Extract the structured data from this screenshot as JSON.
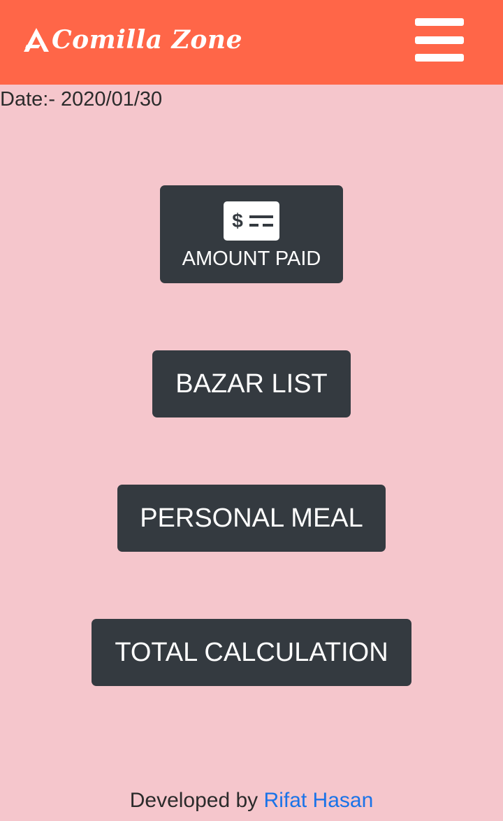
{
  "navbar": {
    "brand": "Comilla Zone",
    "menu_icon": "hamburger-menu-icon",
    "background_color": "#ff6648"
  },
  "date": {
    "text": "Date:- 2020/01/30"
  },
  "buttons": {
    "amount_paid": {
      "label": "AMOUNT PAID",
      "icon": "money-check-icon"
    },
    "bazar_list": {
      "label": "BAZAR LIST"
    },
    "personal_meal": {
      "label": "PERSONAL MEAL"
    },
    "total_calculation": {
      "label": "TOTAL CALCULATION"
    },
    "color": "#343a40"
  },
  "footer": {
    "prefix": "Developed by",
    "author": "Rifat Hasan",
    "link_color": "#1a73e8"
  },
  "page_background": "#f5c6cc"
}
